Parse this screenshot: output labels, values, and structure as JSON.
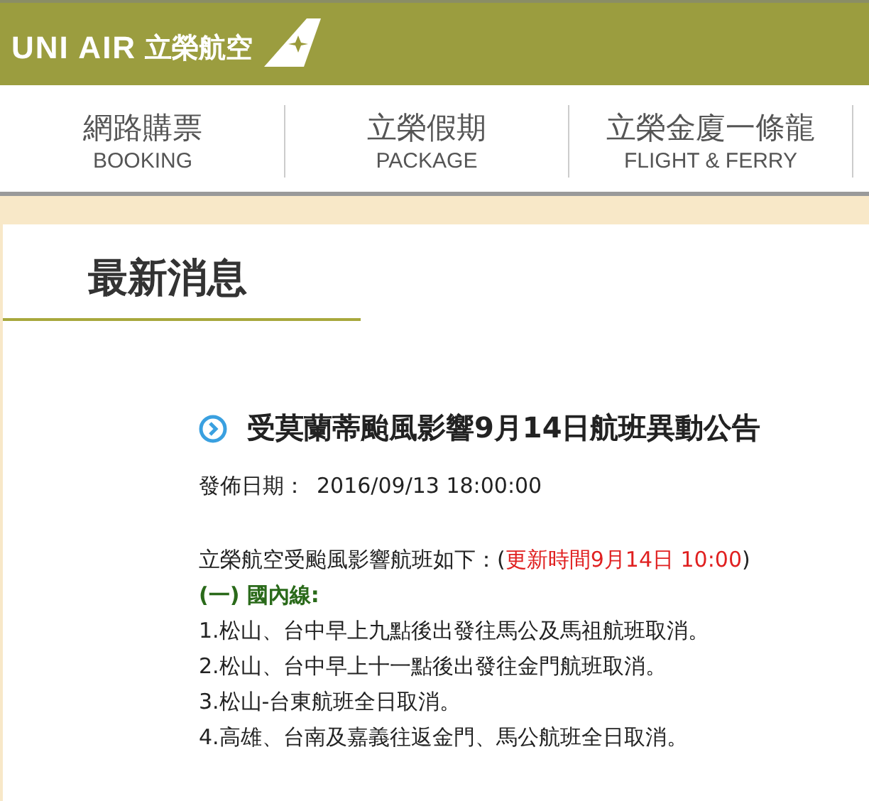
{
  "header": {
    "logo_text": "UNI AIR",
    "logo_chinese": "立榮航空"
  },
  "nav": [
    {
      "label": "網路購票",
      "sublabel": "BOOKING"
    },
    {
      "label": "立榮假期",
      "sublabel": "PACKAGE"
    },
    {
      "label": "立榮金廈一條龍",
      "sublabel": "FLIGHT & FERRY"
    }
  ],
  "section_title": "最新消息",
  "article": {
    "title": "受莫蘭蒂颱風影響9月14日航班異動公告",
    "date_label": "發佈日期：",
    "date": "2016/09/13 18:00:00",
    "intro": "立榮航空受颱風影響航班如下：(",
    "update_time": "更新時間9月14日 10:00",
    "intro_end": ")",
    "subheading": "(一) 國內線:",
    "items": [
      "1.松山、台中早上九點後出發往馬公及馬祖航班取消。",
      "2.松山、台中早上十一點後出發往金門航班取消。",
      "3.松山-台東航班全日取消。",
      "4.高雄、台南及嘉義往返金門、馬公航班全日取消。"
    ]
  }
}
